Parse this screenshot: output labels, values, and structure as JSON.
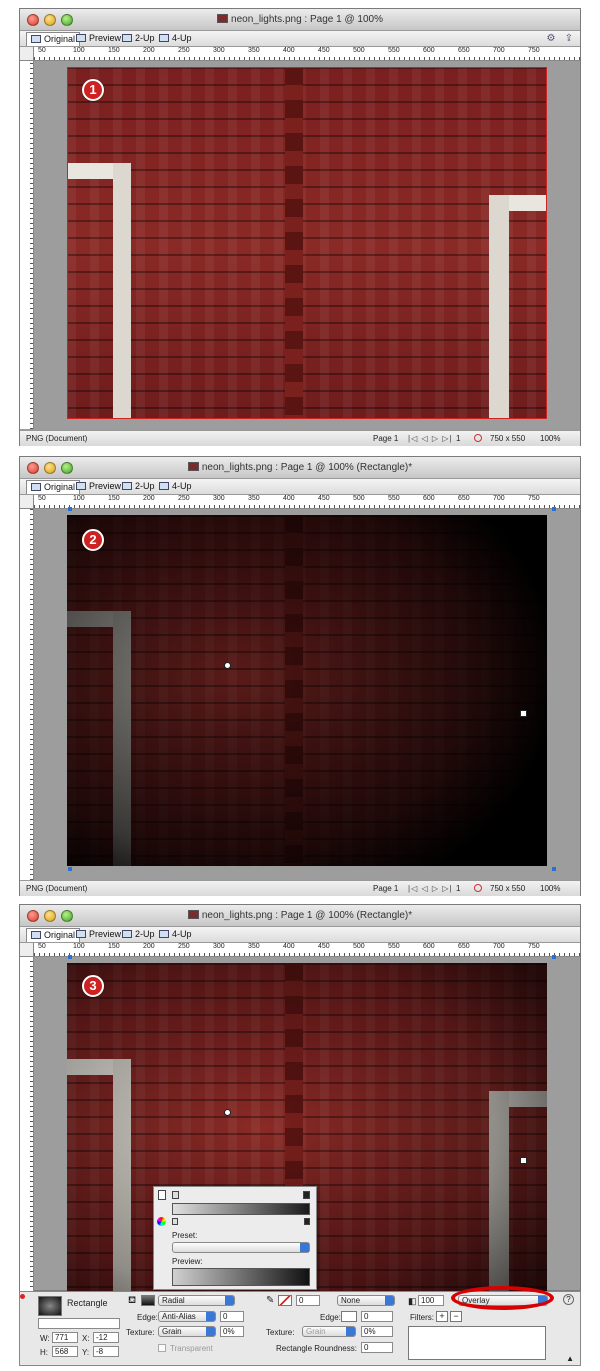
{
  "window1": {
    "title": "neon_lights.png : Page 1 @ 100%",
    "tabs": [
      "Original",
      "Preview",
      "2-Up",
      "4-Up"
    ],
    "ruler_ticks": [
      "50",
      "100",
      "150",
      "200",
      "250",
      "300",
      "350",
      "400",
      "450",
      "500",
      "550",
      "600",
      "650",
      "700",
      "750"
    ],
    "badge": "1",
    "status_left": "PNG (Document)",
    "page_label": "Page 1",
    "page_nav": "|◁ ◁ ▷ ▷|",
    "page_num": "1",
    "size": "750 x 550",
    "zoom": "100%"
  },
  "window2": {
    "title": "neon_lights.png : Page 1 @ 100% (Rectangle)*",
    "tabs": [
      "Original",
      "Preview",
      "2-Up",
      "4-Up"
    ],
    "badge": "2",
    "status_left": "PNG (Document)",
    "page_label": "Page 1",
    "page_num": "1",
    "size": "750 x 550",
    "zoom": "100%"
  },
  "window3": {
    "title": "neon_lights.png : Page 1 @ 100% (Rectangle)*",
    "tabs": [
      "Original",
      "Preview",
      "2-Up",
      "4-Up"
    ],
    "badge": "3"
  },
  "gradient_popup": {
    "preset_label": "Preset:",
    "preview_label": "Preview:"
  },
  "properties": {
    "object_name": "Rectangle",
    "fill_type": "Radial",
    "edge_label": "Edge:",
    "edge_value": "Anti-Alias",
    "edge_amount": "0",
    "texture_label": "Texture:",
    "texture_value": "Grain",
    "texture_amount": "0%",
    "transparent_label": "Transparent",
    "w_label": "W:",
    "w_value": "771",
    "x_label": "X:",
    "x_value": "-12",
    "h_label": "H:",
    "h_value": "568",
    "y_label": "Y:",
    "y_value": "-8",
    "stroke_size": "0",
    "stroke_type": "None",
    "stroke_edge_label": "Edge:",
    "stroke_edge_amount": "0",
    "stroke_texture_label": "Texture:",
    "stroke_texture_value": "Grain",
    "stroke_texture_amount": "0%",
    "roundness_label": "Rectangle Roundness:",
    "roundness_value": "0",
    "opacity": "100",
    "blend_mode": "Overlay",
    "filters_label": "Filters:"
  },
  "colors": {
    "highlight_oval": "#d80000",
    "badge": "#cc2222",
    "selection_handle": "#2a6fd6"
  }
}
